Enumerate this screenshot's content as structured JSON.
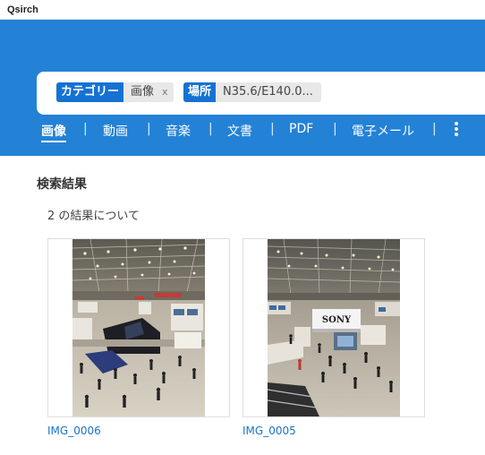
{
  "window": {
    "title": "Qsirch"
  },
  "search": {
    "filters": [
      {
        "key": "カテゴリー",
        "value": "画像",
        "remove": "x"
      },
      {
        "key": "場所",
        "value": "N35.6/E140.0...",
        "remove": "x"
      }
    ]
  },
  "tabs": [
    {
      "label": "画像",
      "active": true
    },
    {
      "label": "動画"
    },
    {
      "label": "音楽"
    },
    {
      "label": "文書"
    },
    {
      "label": "PDF"
    },
    {
      "label": "電子メール"
    }
  ],
  "separator": "|",
  "results": {
    "title": "検索結果",
    "count_text": "2 の結果について",
    "items": [
      {
        "name": "IMG_0006"
      },
      {
        "name": "IMG_0005",
        "photo_sign": "SONY"
      }
    ]
  },
  "colors": {
    "header": "#2382d6",
    "chip_key": "#1572d3",
    "link": "#1a73c9"
  }
}
